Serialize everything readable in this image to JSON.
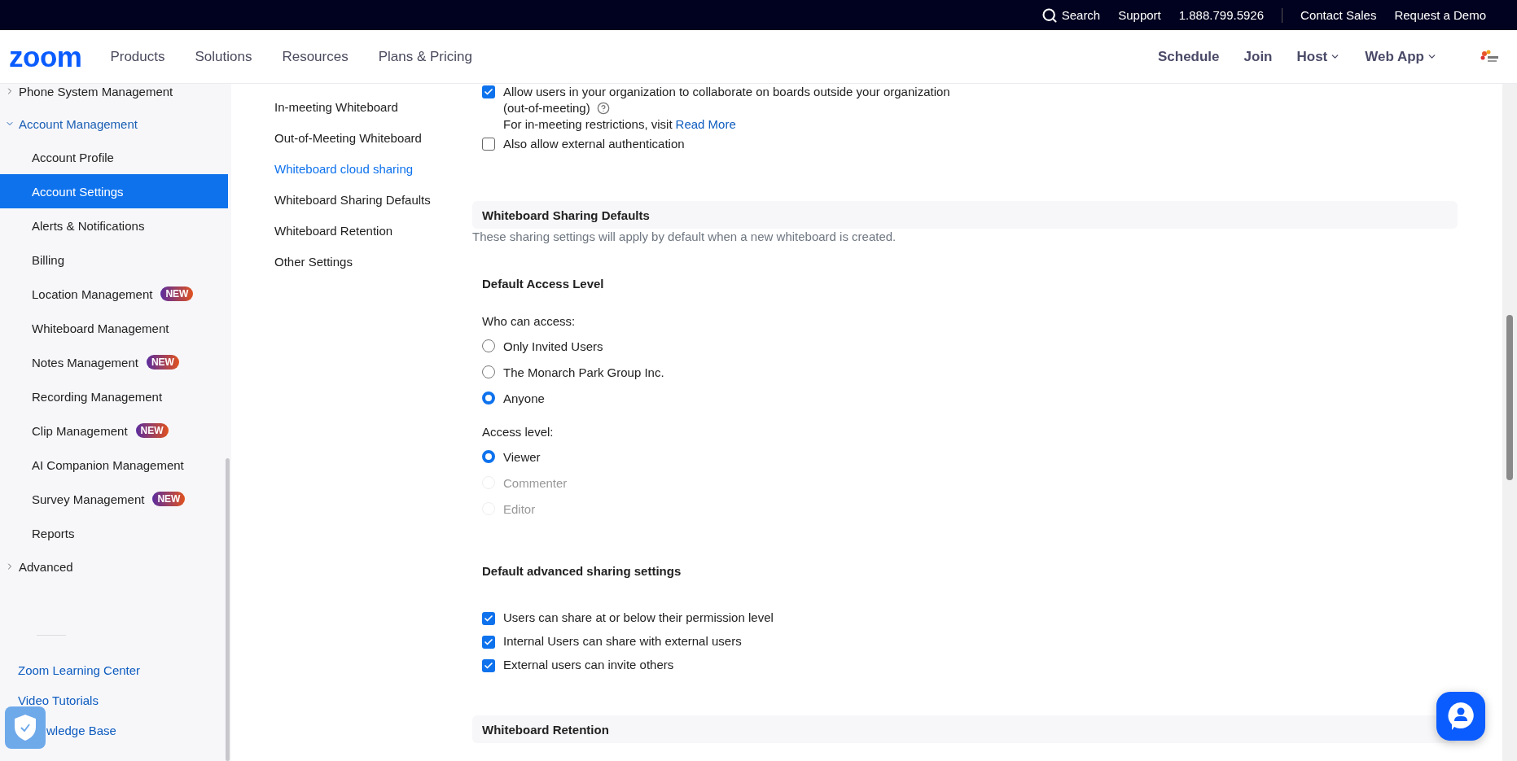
{
  "top_bar": {
    "search": "Search",
    "links": [
      "Support",
      "1.888.799.5926"
    ],
    "right_links": [
      "Contact Sales",
      "Request a Demo"
    ]
  },
  "nav": {
    "logo": "zoom",
    "items": [
      "Products",
      "Solutions",
      "Resources",
      "Plans & Pricing"
    ],
    "right_items": [
      {
        "label": "Schedule",
        "dropdown": false
      },
      {
        "label": "Join",
        "dropdown": false
      },
      {
        "label": "Host",
        "dropdown": true
      },
      {
        "label": "Web App",
        "dropdown": true
      }
    ]
  },
  "sidebar": {
    "items": [
      {
        "label": "Phone System Management",
        "expanded": false
      },
      {
        "label": "Account Management",
        "expanded": true,
        "children": [
          {
            "label": "Account Profile",
            "selected": false
          },
          {
            "label": "Account Settings",
            "selected": true
          },
          {
            "label": "Alerts & Notifications",
            "selected": false
          },
          {
            "label": "Billing",
            "selected": false
          },
          {
            "label": "Location Management",
            "selected": false,
            "badge": "NEW"
          },
          {
            "label": "Whiteboard Management",
            "selected": false
          },
          {
            "label": "Notes Management",
            "selected": false,
            "badge": "NEW"
          },
          {
            "label": "Recording Management",
            "selected": false
          },
          {
            "label": "Clip Management",
            "selected": false,
            "badge": "NEW"
          },
          {
            "label": "AI Companion Management",
            "selected": false
          },
          {
            "label": "Survey Management",
            "selected": false,
            "badge": "NEW"
          },
          {
            "label": "Reports",
            "selected": false
          }
        ]
      },
      {
        "label": "Advanced",
        "expanded": false
      }
    ],
    "links": [
      "Zoom Learning Center",
      "Video Tutorials",
      "wledge Base"
    ]
  },
  "section_nav": [
    {
      "label": "In-meeting Whiteboard",
      "selected": false
    },
    {
      "label": "Out-of-Meeting Whiteboard",
      "selected": false
    },
    {
      "label": "Whiteboard cloud sharing",
      "selected": true
    },
    {
      "label": "Whiteboard Sharing Defaults",
      "selected": false
    },
    {
      "label": "Whiteboard Retention",
      "selected": false
    },
    {
      "label": "Other Settings",
      "selected": false
    }
  ],
  "settings": {
    "top_options": [
      {
        "label": "Allow users in your organization to collaborate on boards outside your organization",
        "checked": true,
        "note": "(out-of-meeting)",
        "info": "For in-meeting restrictions, visit",
        "link": "Read More"
      },
      {
        "label": "Also allow external authentication",
        "checked": false
      }
    ],
    "sections": [
      {
        "title": "Whiteboard Sharing Defaults",
        "description": "These sharing settings will apply by default when a new whiteboard is created.",
        "groups": [
          {
            "title": "Default Access Level",
            "fields": [
              {
                "kind": "radio",
                "label": "Who can access:",
                "options": [
                  {
                    "label": "Only Invited Users",
                    "selected": false,
                    "disabled": false
                  },
                  {
                    "label": "The Monarch Park Group Inc.",
                    "selected": false,
                    "disabled": false
                  },
                  {
                    "label": "Anyone",
                    "selected": true,
                    "disabled": false
                  }
                ]
              },
              {
                "kind": "radio",
                "label": "Access level:",
                "options": [
                  {
                    "label": "Viewer",
                    "selected": true,
                    "disabled": false
                  },
                  {
                    "label": "Commenter",
                    "selected": false,
                    "disabled": true
                  },
                  {
                    "label": "Editor",
                    "selected": false,
                    "disabled": true
                  }
                ]
              }
            ]
          },
          {
            "title": "Default advanced sharing settings",
            "fields": [
              {
                "kind": "checkbox",
                "options": [
                  {
                    "label": "Users can share at or below their permission level",
                    "checked": true
                  },
                  {
                    "label": "Internal Users can share with external users",
                    "checked": true
                  },
                  {
                    "label": "External users can invite others",
                    "checked": true
                  }
                ]
              }
            ]
          }
        ]
      },
      {
        "title": "Whiteboard Retention"
      }
    ]
  }
}
